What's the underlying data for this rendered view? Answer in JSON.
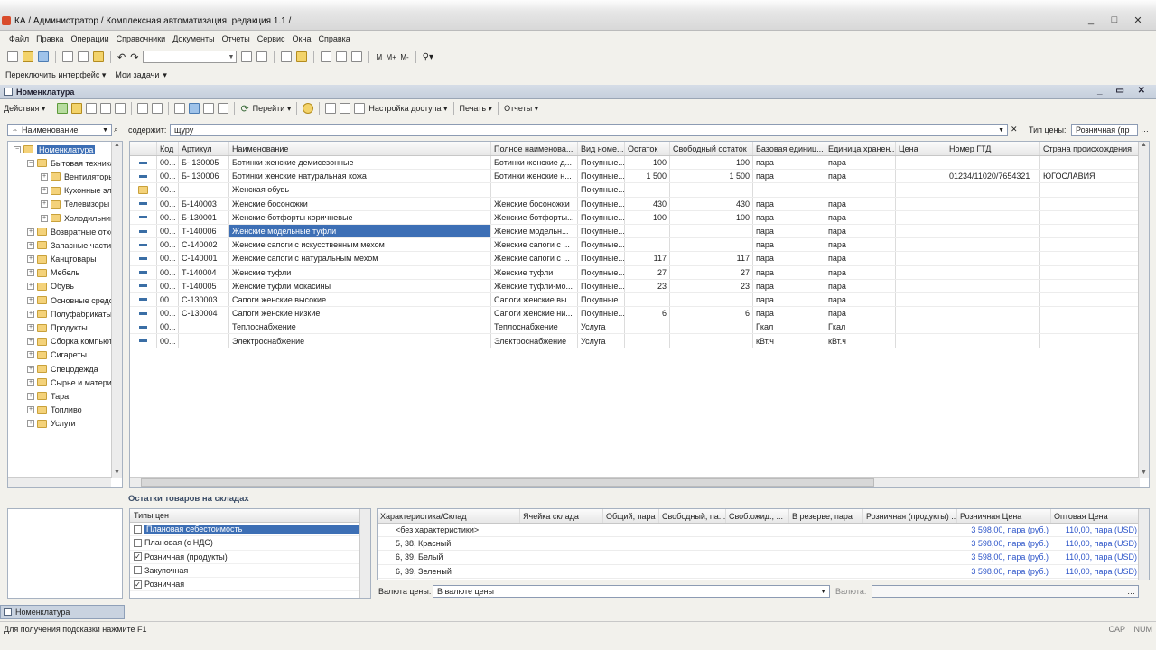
{
  "window": {
    "title": "КА / Администратор / Комплексная автоматизация, редакция 1.1 /",
    "controls": [
      "_",
      "□",
      "✕"
    ]
  },
  "menu": [
    "Файл",
    "Правка",
    "Операции",
    "Справочники",
    "Документы",
    "Отчеты",
    "Сервис",
    "Окна",
    "Справка"
  ],
  "toolbar2": {
    "switch_interface": "Переключить интерфейс ▾",
    "my_tasks": "Мои задачи"
  },
  "panel": {
    "title": "Номенклатура"
  },
  "toolbar3": {
    "actions": "Действия ▾",
    "goto": "Перейти ▾",
    "access": "Настройка доступа ▾",
    "print": "Печать ▾",
    "reports": "Отчеты ▾"
  },
  "filter": {
    "field": "Наименование",
    "contains_label": "содержит:",
    "contains_value": "щуру",
    "price_type_label": "Тип цены:",
    "price_type_value": "Розничная (пр"
  },
  "tree": {
    "items": [
      {
        "label": "Номенклатура",
        "level": 0,
        "expander": "−"
      },
      {
        "label": "Бытовая техника",
        "level": 1,
        "expander": "−"
      },
      {
        "label": "Вентиляторы",
        "level": 2,
        "expander": "+"
      },
      {
        "label": "Кухонные электроприборы",
        "level": 2,
        "expander": "+"
      },
      {
        "label": "Телевизоры",
        "level": 2,
        "expander": "+"
      },
      {
        "label": "Холодильники",
        "level": 2,
        "expander": "+"
      },
      {
        "label": "Возвратные отходы",
        "level": 1,
        "expander": "+"
      },
      {
        "label": "Запасные части",
        "level": 1,
        "expander": "+"
      },
      {
        "label": "Канцтовары",
        "level": 1,
        "expander": "+"
      },
      {
        "label": "Мебель",
        "level": 1,
        "expander": "+"
      },
      {
        "label": "Обувь",
        "level": 1,
        "expander": "+"
      },
      {
        "label": "Основные средства",
        "level": 1,
        "expander": "+"
      },
      {
        "label": "Полуфабрикаты",
        "level": 1,
        "expander": "+"
      },
      {
        "label": "Продукты",
        "level": 1,
        "expander": "+"
      },
      {
        "label": "Сборка компьютеров",
        "level": 1,
        "expander": "+"
      },
      {
        "label": "Сигареты",
        "level": 1,
        "expander": "+"
      },
      {
        "label": "Спецодежда",
        "level": 1,
        "expander": "+"
      },
      {
        "label": "Сырье и материалы",
        "level": 1,
        "expander": "+"
      },
      {
        "label": "Тара",
        "level": 1,
        "expander": "+"
      },
      {
        "label": "Топливо",
        "level": 1,
        "expander": "+"
      },
      {
        "label": "Услуги",
        "level": 1,
        "expander": "+"
      }
    ]
  },
  "grid": {
    "columns": [
      "Код",
      "Артикул",
      "Наименование",
      "Полное наименова...",
      "Вид номе...",
      "Остаток",
      "Свободный остаток",
      "Базовая единиц...",
      "Единица хранен...",
      "Цена",
      "Номер ГТД",
      "Страна происхождения"
    ],
    "rows": [
      {
        "kind": "item",
        "cells": [
          "00...",
          "Б- 130005",
          "Ботинки женские демисезонные",
          "Ботинки женские д...",
          "Покупные...",
          "100",
          "100",
          "пара",
          "пара",
          "",
          "",
          ""
        ]
      },
      {
        "kind": "item",
        "cells": [
          "00...",
          "Б- 130006",
          "Ботинки женские натуральная кожа",
          "Ботинки женские н...",
          "Покупные...",
          "1 500",
          "1 500",
          "пара",
          "пара",
          "",
          "01234/11020/7654321",
          "ЮГОСЛАВИЯ"
        ]
      },
      {
        "kind": "folder",
        "cells": [
          "00...",
          "",
          "Женская обувь",
          "",
          "Покупные...",
          "",
          "",
          "",
          "",
          "",
          "",
          ""
        ]
      },
      {
        "kind": "item",
        "cells": [
          "00...",
          "Б-140003",
          "Женские босоножки",
          "Женские босоножки",
          "Покупные...",
          "430",
          "430",
          "пара",
          "пара",
          "",
          "",
          ""
        ]
      },
      {
        "kind": "item",
        "cells": [
          "00...",
          "Б-130001",
          "Женские ботфорты коричневые",
          "Женские ботфорты...",
          "Покупные...",
          "100",
          "100",
          "пара",
          "пара",
          "",
          "",
          ""
        ]
      },
      {
        "kind": "item",
        "selected": true,
        "cells": [
          "00...",
          "Т-140006",
          "Женские модельные туфли",
          "Женские модельн...",
          "Покупные...",
          "",
          "",
          "пара",
          "пара",
          "",
          "",
          ""
        ]
      },
      {
        "kind": "item",
        "cells": [
          "00...",
          "С-140002",
          "Женские сапоги с искусственным мехом",
          "Женские сапоги с ...",
          "Покупные...",
          "",
          "",
          "пара",
          "пара",
          "",
          "",
          ""
        ]
      },
      {
        "kind": "item",
        "cells": [
          "00...",
          "С-140001",
          "Женские сапоги с натуральным мехом",
          "Женские сапоги с ...",
          "Покупные...",
          "117",
          "117",
          "пара",
          "пара",
          "",
          "",
          ""
        ]
      },
      {
        "kind": "item",
        "cells": [
          "00...",
          "Т-140004",
          "Женские туфли",
          "Женские туфли",
          "Покупные...",
          "27",
          "27",
          "пара",
          "пара",
          "",
          "",
          ""
        ]
      },
      {
        "kind": "item",
        "cells": [
          "00...",
          "Т-140005",
          "Женские туфли мокасины",
          "Женские туфли-мо...",
          "Покупные...",
          "23",
          "23",
          "пара",
          "пара",
          "",
          "",
          ""
        ]
      },
      {
        "kind": "item",
        "cells": [
          "00...",
          "С-130003",
          "Сапоги женские высокие",
          "Сапоги женские вы...",
          "Покупные...",
          "",
          "",
          "пара",
          "пара",
          "",
          "",
          ""
        ]
      },
      {
        "kind": "item",
        "cells": [
          "00...",
          "С-130004",
          "Сапоги женские низкие",
          "Сапоги женские ни...",
          "Покупные...",
          "6",
          "6",
          "пара",
          "пара",
          "",
          "",
          ""
        ]
      },
      {
        "kind": "item",
        "cells": [
          "00...",
          "",
          "Теплоснабжение",
          "Теплоснабжение",
          "Услуга",
          "",
          "",
          "Гкал",
          "Гкал",
          "",
          "",
          ""
        ]
      },
      {
        "kind": "item",
        "cells": [
          "00...",
          "",
          "Электроснабжение",
          "Электроснабжение",
          "Услуга",
          "",
          "",
          "кВт.ч",
          "кВт.ч",
          "",
          "",
          ""
        ]
      }
    ]
  },
  "stock_section": {
    "title": "Остатки товаров на складах"
  },
  "price_types": {
    "header": "Типы цен",
    "items": [
      {
        "label": "Плановая себестоимость",
        "checked": false,
        "selected": true
      },
      {
        "label": "Плановая (с НДС)",
        "checked": false
      },
      {
        "label": "Розничная (продукты)",
        "checked": true
      },
      {
        "label": "Закупочная",
        "checked": false
      },
      {
        "label": "Розничная",
        "checked": true
      }
    ]
  },
  "stock_grid": {
    "columns": [
      "Характеристика/Склад",
      "Ячейка склада",
      "Общий, пара",
      "Свободный, па...",
      "Своб.ожид., ...",
      "В резерве, пара",
      "Розничная (продукты) ...",
      "Розничная Цена",
      "Оптовая Цена"
    ],
    "rows": [
      [
        "<без характеристики>",
        "",
        "",
        "",
        "",
        "",
        "",
        "3 598,00, пара (руб.)",
        "110,00, пара (USD)"
      ],
      [
        "5, 38, Красный",
        "",
        "",
        "",
        "",
        "",
        "",
        "3 598,00, пара (руб.)",
        "110,00, пара (USD)"
      ],
      [
        "6, 39, Белый",
        "",
        "",
        "",
        "",
        "",
        "",
        "3 598,00, пара (руб.)",
        "110,00, пара (USD)"
      ],
      [
        "6, 39, Зеленый",
        "",
        "",
        "",
        "",
        "",
        "",
        "3 598,00, пара (руб.)",
        "110,00, пара (USD)"
      ]
    ]
  },
  "currency": {
    "label": "Валюта цены:",
    "value": "В валюте цены",
    "label2": "Валюта:",
    "value2": ""
  },
  "taskbar": {
    "tab": "Номенклатура"
  },
  "status": {
    "hint": "Для получения подсказки нажмите F1",
    "cap": "CAP",
    "num": "NUM"
  },
  "colors": {
    "selection": "#3d6fb5",
    "panel_header": "#c5cfdc",
    "price_blue": "#2d55c9"
  }
}
